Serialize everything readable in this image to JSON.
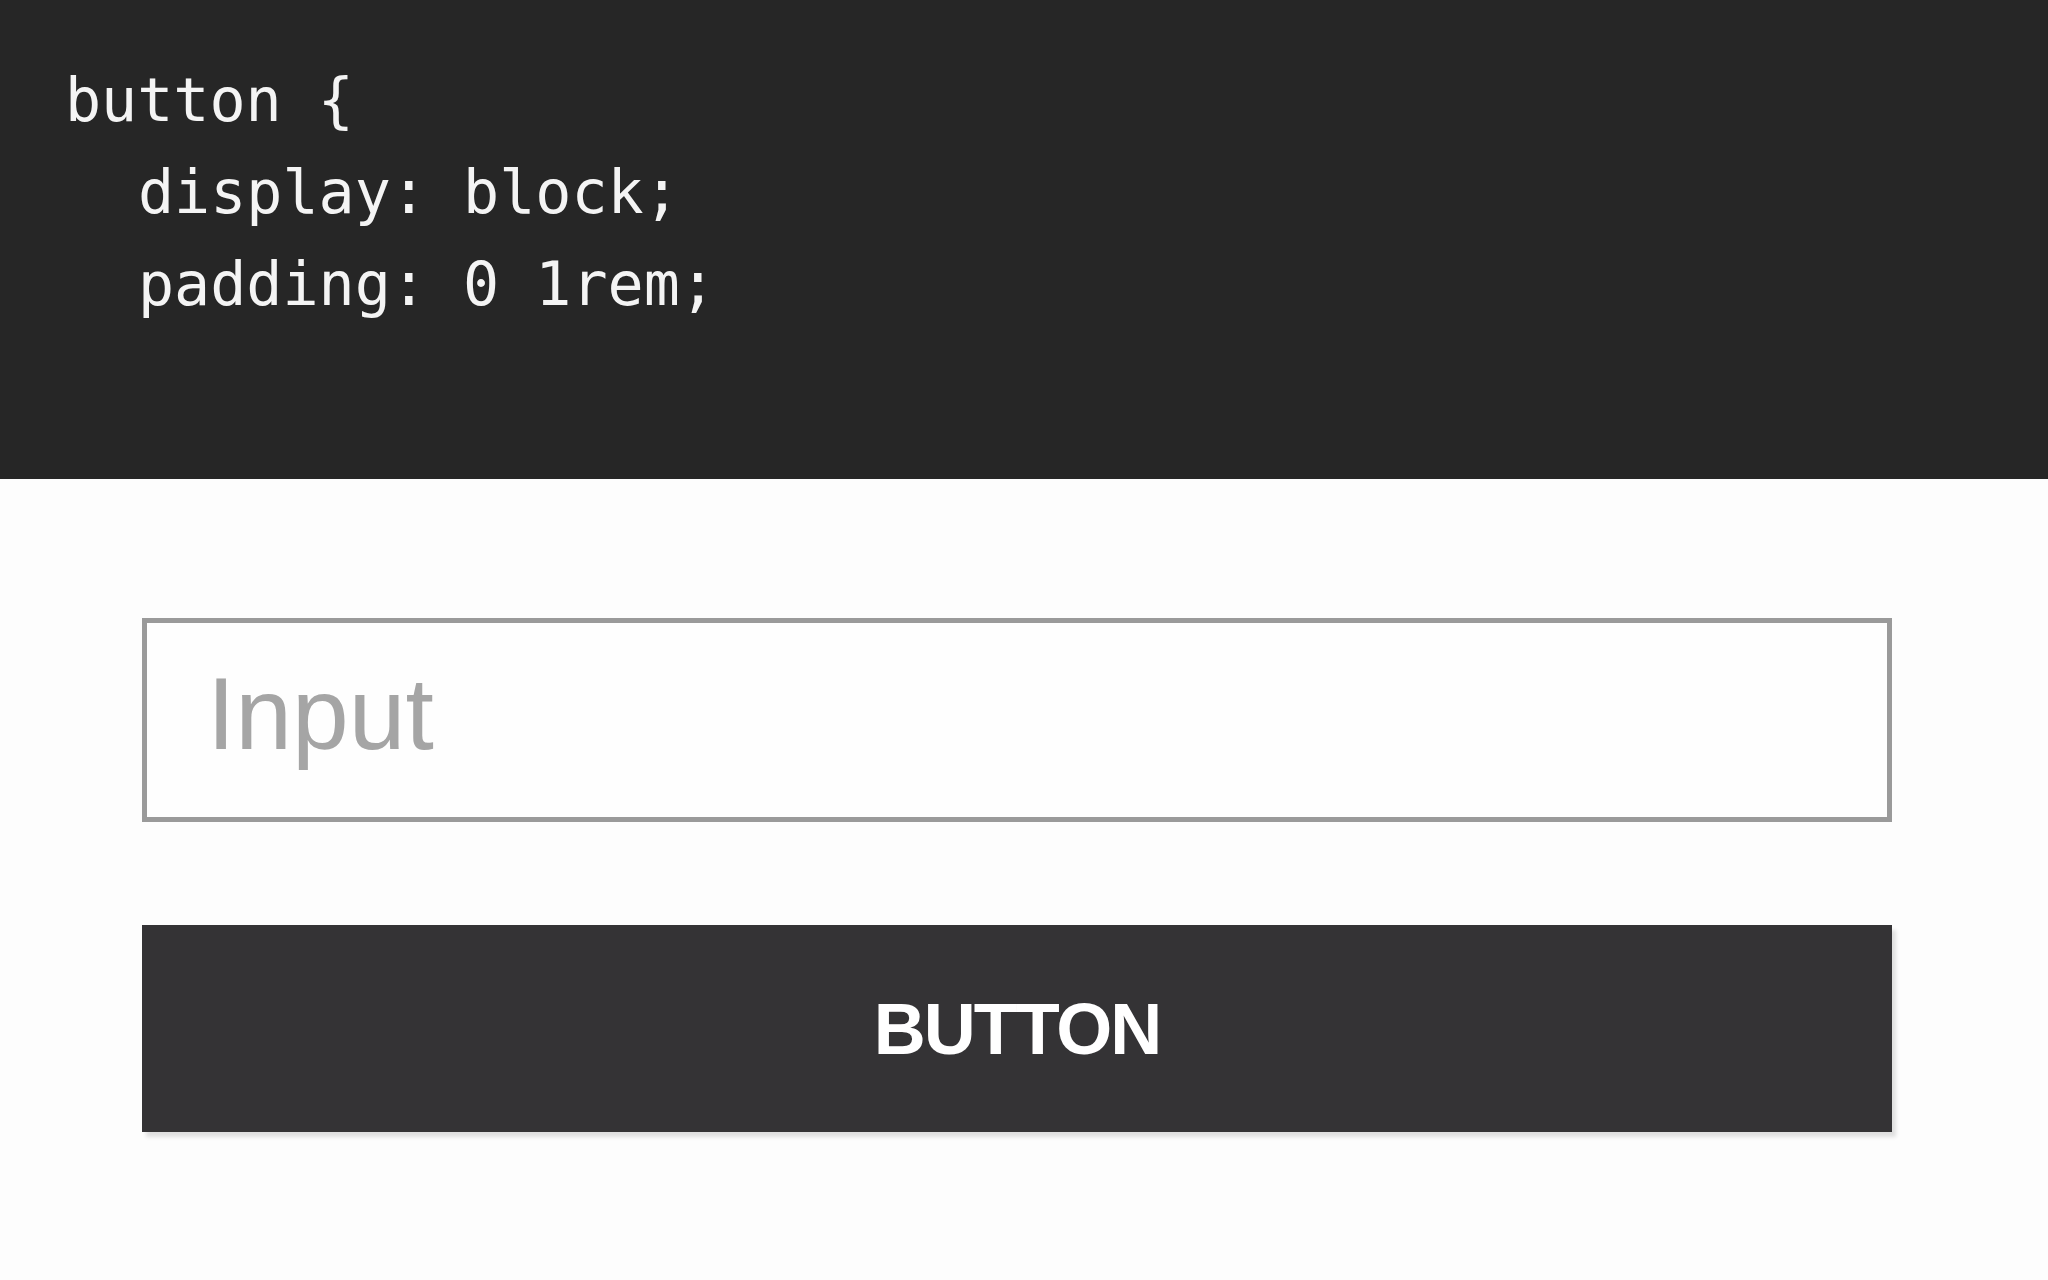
{
  "code": {
    "lines": [
      {
        "text": "button {",
        "children": [
          {
            "text": "display: block;"
          },
          {
            "text": "padding: 0 1rem;"
          }
        ]
      }
    ]
  },
  "input": {
    "placeholder": "Input"
  },
  "button": {
    "label": "BUTTON"
  }
}
